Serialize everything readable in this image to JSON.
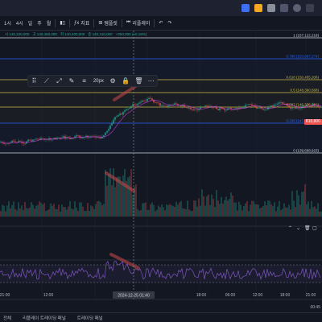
{
  "toolbar": {
    "items": [
      "1시",
      "4시",
      "일",
      "주",
      "월",
      "지표",
      "템플릿",
      "리플레이"
    ]
  },
  "ohlc": {
    "values": [
      "시 140,100,000",
      "고 140,460,000",
      "저 140,400,000",
      "종 140,410,000",
      "+250,000 (+0.18%)"
    ]
  },
  "drawbar": {
    "line_width_label": "20px"
  },
  "fib": {
    "levels": [
      {
        "ratio": "1",
        "label": "1 (157,122,218)",
        "color": "#d1d4dc"
      },
      {
        "ratio": "0.786",
        "label": "0.786 (153,687,274)",
        "color": "#2962ff"
      },
      {
        "ratio": "0.618",
        "label": "0.618 (150,455,206)",
        "color": "#c8b94a"
      },
      {
        "ratio": "0.5",
        "label": "0.5 (148,390,568)",
        "color": "#c8b94a"
      },
      {
        "ratio": "0.382",
        "label": "0.382 (146,326,061)",
        "color": "#c8b94a"
      },
      {
        "ratio": "0.236",
        "label": "0.236 (143,774,864)",
        "color": "#2962ff"
      },
      {
        "ratio": "0",
        "label": "0 (139,668,923)",
        "color": "#d1d4dc"
      }
    ]
  },
  "price_tag": {
    "current": "810,800"
  },
  "time_axis": {
    "ticks": [
      "21:00",
      "12:00",
      "18:00",
      "06:00",
      "12:00",
      "18:00",
      "21:00"
    ],
    "highlight": "2024-12-25  01:40",
    "right": "00:45"
  },
  "bottom_tabs": [
    "전체",
    "리플레이 트레이딩 패널",
    "트레이딩 패널"
  ],
  "colors": {
    "background": "#131722",
    "up": "#26a69a",
    "down": "#ef5350",
    "rsi": "#7e57c2",
    "ma": "#e040fb"
  }
}
